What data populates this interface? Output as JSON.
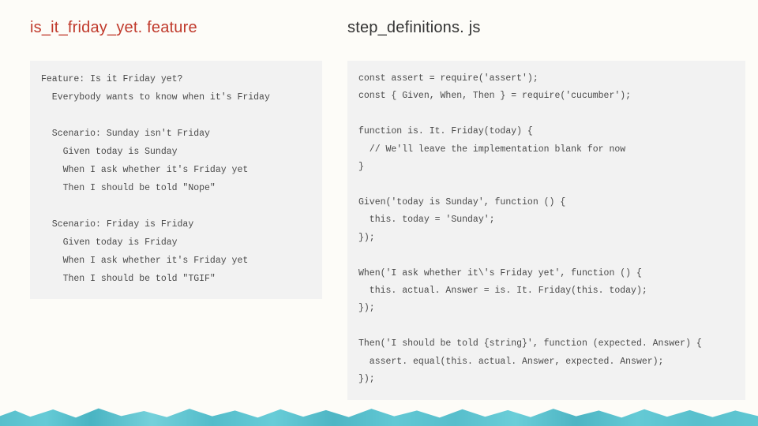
{
  "left": {
    "heading": "is_it_friday_yet. feature",
    "code": "Feature: Is it Friday yet?\n  Everybody wants to know when it's Friday\n\n  Scenario: Sunday isn't Friday\n    Given today is Sunday\n    When I ask whether it's Friday yet\n    Then I should be told \"Nope\"\n\n  Scenario: Friday is Friday\n    Given today is Friday\n    When I ask whether it's Friday yet\n    Then I should be told \"TGIF\""
  },
  "right": {
    "heading": "step_definitions. js",
    "code": "const assert = require('assert');\nconst { Given, When, Then } = require('cucumber');\n\nfunction is. It. Friday(today) {\n  // We'll leave the implementation blank for now\n}\n\nGiven('today is Sunday', function () {\n  this. today = 'Sunday';\n});\n\nWhen('I ask whether it\\'s Friday yet', function () {\n  this. actual. Answer = is. It. Friday(this. today);\n});\n\nThen('I should be told {string}', function (expected. Answer) {\n  assert. equal(this. actual. Answer, expected. Answer);\n});"
  }
}
